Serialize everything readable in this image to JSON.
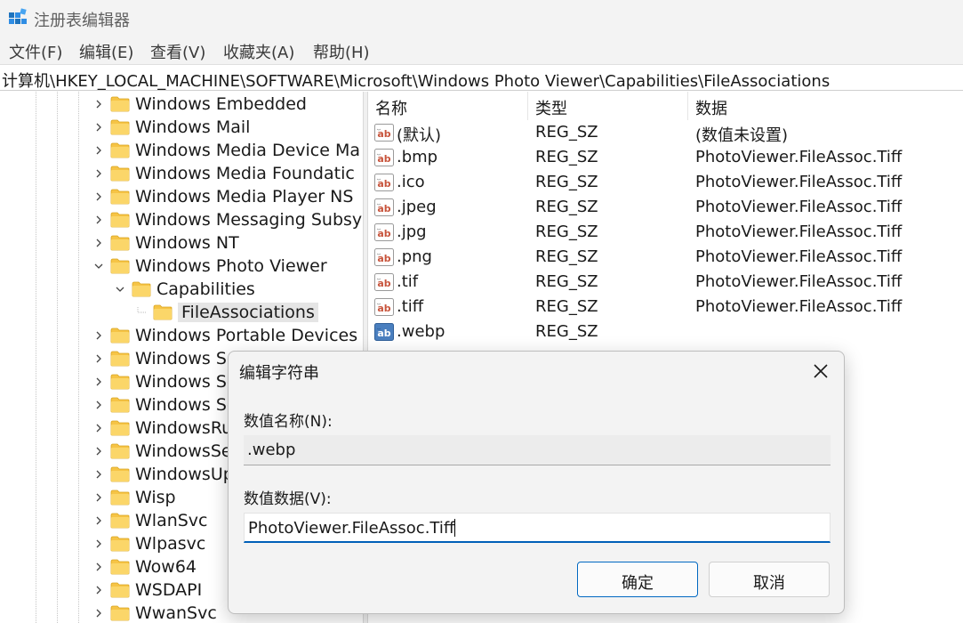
{
  "window": {
    "title": "注册表编辑器"
  },
  "menu": [
    "文件(F)",
    "编辑(E)",
    "查看(V)",
    "收藏夹(A)",
    "帮助(H)"
  ],
  "address": "计算机\\HKEY_LOCAL_MACHINE\\SOFTWARE\\Microsoft\\Windows Photo Viewer\\Capabilities\\FileAssociations",
  "tree": {
    "items": [
      {
        "label": "Windows Embedded",
        "expander": "collapsed"
      },
      {
        "label": "Windows Mail",
        "expander": "collapsed"
      },
      {
        "label": "Windows Media Device Ma",
        "expander": "collapsed"
      },
      {
        "label": "Windows Media Foundatic",
        "expander": "collapsed"
      },
      {
        "label": "Windows Media Player NS",
        "expander": "collapsed"
      },
      {
        "label": "Windows Messaging Subsy",
        "expander": "collapsed"
      },
      {
        "label": "Windows NT",
        "expander": "collapsed"
      },
      {
        "label": "Windows Photo Viewer",
        "expander": "expanded"
      },
      {
        "label": "Capabilities",
        "expander": "expanded"
      },
      {
        "label": "FileAssociations",
        "expander": "none",
        "selected": true
      },
      {
        "label": "Windows Portable Devices",
        "expander": "collapsed"
      },
      {
        "label": "Windows Sc",
        "expander": "collapsed"
      },
      {
        "label": "Windows Se",
        "expander": "collapsed"
      },
      {
        "label": "Windows Se",
        "expander": "collapsed"
      },
      {
        "label": "WindowsRu",
        "expander": "collapsed"
      },
      {
        "label": "WindowsSel",
        "expander": "collapsed"
      },
      {
        "label": "WindowsUp",
        "expander": "collapsed"
      },
      {
        "label": "Wisp",
        "expander": "collapsed"
      },
      {
        "label": "WlanSvc",
        "expander": "collapsed"
      },
      {
        "label": "Wlpasvc",
        "expander": "collapsed"
      },
      {
        "label": "Wow64",
        "expander": "collapsed"
      },
      {
        "label": "WSDAPI",
        "expander": "collapsed"
      },
      {
        "label": "WwanSvc",
        "expander": "collapsed"
      }
    ]
  },
  "values": {
    "headers": {
      "name": "名称",
      "type": "类型",
      "data": "数据"
    },
    "rows": [
      {
        "name": "(默认)",
        "type": "REG_SZ",
        "data": "(数值未设置)"
      },
      {
        "name": ".bmp",
        "type": "REG_SZ",
        "data": "PhotoViewer.FileAssoc.Tiff"
      },
      {
        "name": ".ico",
        "type": "REG_SZ",
        "data": "PhotoViewer.FileAssoc.Tiff"
      },
      {
        "name": ".jpeg",
        "type": "REG_SZ",
        "data": "PhotoViewer.FileAssoc.Tiff"
      },
      {
        "name": ".jpg",
        "type": "REG_SZ",
        "data": "PhotoViewer.FileAssoc.Tiff"
      },
      {
        "name": ".png",
        "type": "REG_SZ",
        "data": "PhotoViewer.FileAssoc.Tiff"
      },
      {
        "name": ".tif",
        "type": "REG_SZ",
        "data": "PhotoViewer.FileAssoc.Tiff"
      },
      {
        "name": ".tiff",
        "type": "REG_SZ",
        "data": "PhotoViewer.FileAssoc.Tiff"
      },
      {
        "name": ".webp",
        "type": "REG_SZ",
        "data": ""
      }
    ]
  },
  "dialog": {
    "title": "编辑字符串",
    "name_label": "数值名称(N):",
    "name_value": ".webp",
    "data_label": "数值数据(V):",
    "data_value": "PhotoViewer.FileAssoc.Tiff",
    "ok_label": "确定",
    "cancel_label": "取消"
  },
  "colors": {
    "accent": "#005fb8",
    "folder": "#f6c446",
    "string_icon": "#c8553d",
    "new_icon": "#4a7fbf"
  },
  "icons": {
    "app": "registry-editor-icon",
    "folder": "folder-icon",
    "string_value": "ab-string-icon",
    "close": "close-icon"
  }
}
